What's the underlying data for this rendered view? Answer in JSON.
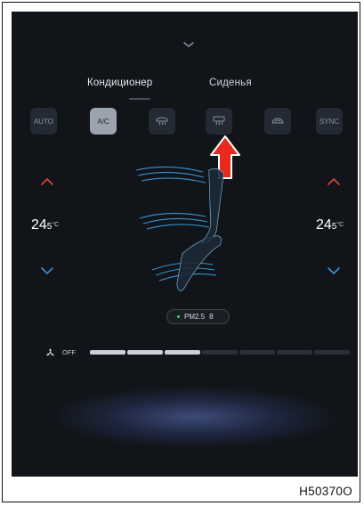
{
  "tabs": [
    {
      "label": "Кондиционер",
      "active": true
    },
    {
      "label": "Сиденья",
      "active": false
    }
  ],
  "quick_buttons": [
    {
      "label": "AUTO",
      "active": false
    },
    {
      "label": "A/C",
      "active": true
    },
    {
      "icon": "front-defrost-icon",
      "active": false
    },
    {
      "icon": "rear-defrost-icon",
      "active": false
    },
    {
      "icon": "air-recirculation-icon",
      "active": false
    },
    {
      "label": "SYNC",
      "active": false
    }
  ],
  "temperature": {
    "left": {
      "whole": "24",
      "decimal": "5",
      "unit": "°C"
    },
    "right": {
      "whole": "24",
      "decimal": "5",
      "unit": "°C"
    }
  },
  "pm": {
    "label": "PM2.5",
    "value": "8"
  },
  "fan": {
    "label": "OFF",
    "level": 3,
    "max_level": 7
  },
  "caption": "H50370O",
  "colors": {
    "screen_bg": "#111418",
    "temp_up": "#e0463f",
    "temp_down": "#3b8fe0",
    "airflow": "#3ea8f2",
    "callout_arrow": "#e8291d"
  }
}
